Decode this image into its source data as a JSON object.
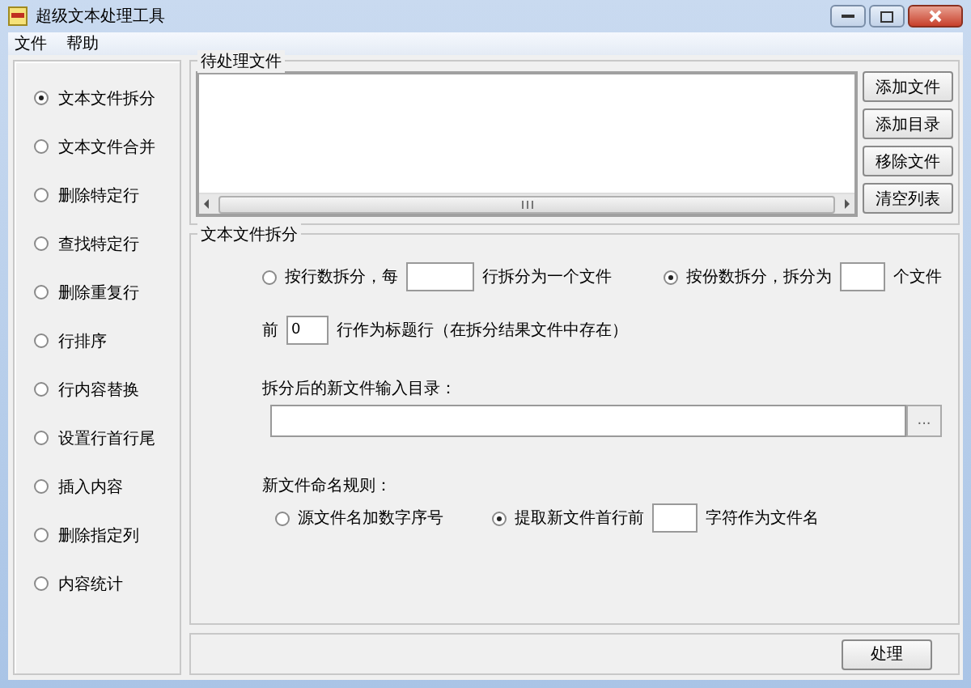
{
  "window": {
    "title": "超级文本处理工具"
  },
  "menu": [
    "文件",
    "帮助"
  ],
  "sidebar": {
    "items": [
      {
        "label": "文本文件拆分",
        "selected": true
      },
      {
        "label": "文本文件合并",
        "selected": false
      },
      {
        "label": "删除特定行",
        "selected": false
      },
      {
        "label": "查找特定行",
        "selected": false
      },
      {
        "label": "删除重复行",
        "selected": false
      },
      {
        "label": "行排序",
        "selected": false
      },
      {
        "label": "行内容替换",
        "selected": false
      },
      {
        "label": "设置行首行尾",
        "selected": false
      },
      {
        "label": "插入内容",
        "selected": false
      },
      {
        "label": "删除指定列",
        "selected": false
      },
      {
        "label": "内容统计",
        "selected": false
      }
    ]
  },
  "file_list": {
    "title": "待处理文件"
  },
  "file_buttons": [
    "添加文件",
    "添加目录",
    "移除文件",
    "清空列表"
  ],
  "split": {
    "title": "文本文件拆分",
    "by_lines": {
      "label": "按行数拆分，每",
      "suffix": "行拆分为一个文件",
      "selected": false
    },
    "by_count": {
      "label": "按份数拆分，拆分为",
      "suffix": "个文件",
      "selected": true
    },
    "header": {
      "prefix": "前",
      "value": "0",
      "suffix": "行作为标题行（在拆分结果文件中存在）"
    },
    "output_dir": {
      "label": "拆分后的新文件输入目录：",
      "browse": "..."
    },
    "naming": {
      "label": "新文件命名规则：",
      "options": [
        {
          "label": "源文件名加数字序号",
          "selected": false
        },
        {
          "label": "提取新文件首行前",
          "suffix": "字符作为文件名",
          "selected": true
        }
      ]
    }
  },
  "process_button": "处理"
}
